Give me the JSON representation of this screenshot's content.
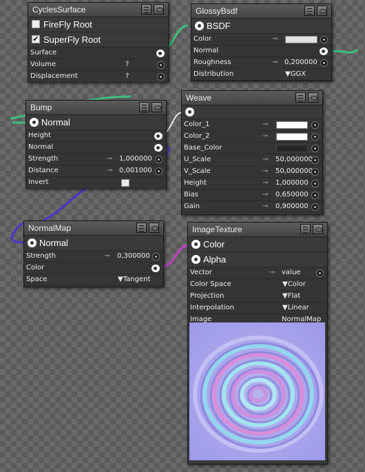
{
  "nodes": {
    "cycles_surface": {
      "title": "CyclesSurface",
      "options": [
        "FireFly Root",
        "SuperFly Root"
      ],
      "inputs": [
        {
          "label": "Surface",
          "value": ""
        },
        {
          "label": "Volume",
          "value": "?"
        },
        {
          "label": "Displacement",
          "value": "?"
        }
      ]
    },
    "glossy": {
      "title": "GlossyBsdf",
      "output": "BSDF",
      "rows": [
        {
          "label": "Color",
          "value": ""
        },
        {
          "label": "Normal",
          "value": ""
        },
        {
          "label": "Roughness",
          "value": "0,200000"
        },
        {
          "label": "Distribution",
          "value": "GGX"
        }
      ]
    },
    "bump": {
      "title": "Bump",
      "output": "Normal",
      "rows": [
        {
          "label": "Height",
          "value": ""
        },
        {
          "label": "Normal",
          "value": ""
        },
        {
          "label": "Strength",
          "value": "1,000000"
        },
        {
          "label": "Distance",
          "value": "0,001000"
        },
        {
          "label": "Invert",
          "value": ""
        }
      ]
    },
    "weave": {
      "title": "Weave",
      "rows": [
        {
          "label": "Color_1",
          "value": ""
        },
        {
          "label": "Color_2",
          "value": ""
        },
        {
          "label": "Base_Color",
          "value": ""
        },
        {
          "label": "U_Scale",
          "value": "50,000000"
        },
        {
          "label": "V_Scale",
          "value": "50,000000"
        },
        {
          "label": "Height",
          "value": "1,000000"
        },
        {
          "label": "Bias",
          "value": "0,650000"
        },
        {
          "label": "Gain",
          "value": "0,900000"
        }
      ]
    },
    "normalmap": {
      "title": "NormalMap",
      "output": "Normal",
      "rows": [
        {
          "label": "Strength",
          "value": "0,300000"
        },
        {
          "label": "Color",
          "value": ""
        },
        {
          "label": "Space",
          "value": "Tangent"
        }
      ]
    },
    "image_texture": {
      "title": "ImageTexture",
      "outputs": [
        "Color",
        "Alpha"
      ],
      "rows": [
        {
          "label": "Vector",
          "value": "value"
        },
        {
          "label": "Color Space",
          "value": "Color"
        },
        {
          "label": "Projection",
          "value": "Flat"
        },
        {
          "label": "Interpolation",
          "value": "Linear"
        },
        {
          "label": "Image",
          "value": "NormalMap"
        }
      ]
    }
  },
  "colors": {
    "wire_green": "#3fbf7f",
    "wire_purple": "#4b36c9",
    "wire_magenta": "#c23fbf",
    "background": "#5b5b5b"
  }
}
